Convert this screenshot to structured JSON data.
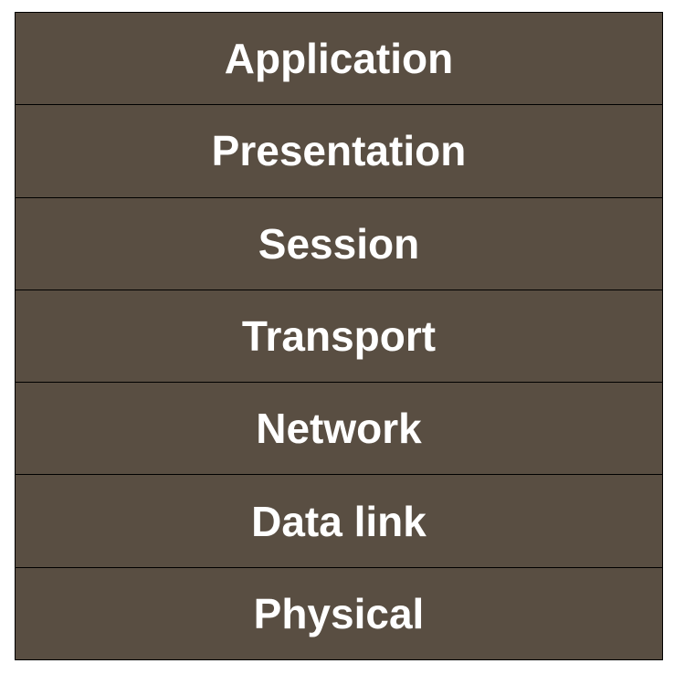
{
  "colors": {
    "layer_fill": "#594e42",
    "label_text": "#ffffff",
    "border": "#000000"
  },
  "layers": [
    {
      "label": "Application"
    },
    {
      "label": "Presentation"
    },
    {
      "label": "Session"
    },
    {
      "label": "Transport"
    },
    {
      "label": "Network"
    },
    {
      "label": "Data link"
    },
    {
      "label": "Physical"
    }
  ]
}
